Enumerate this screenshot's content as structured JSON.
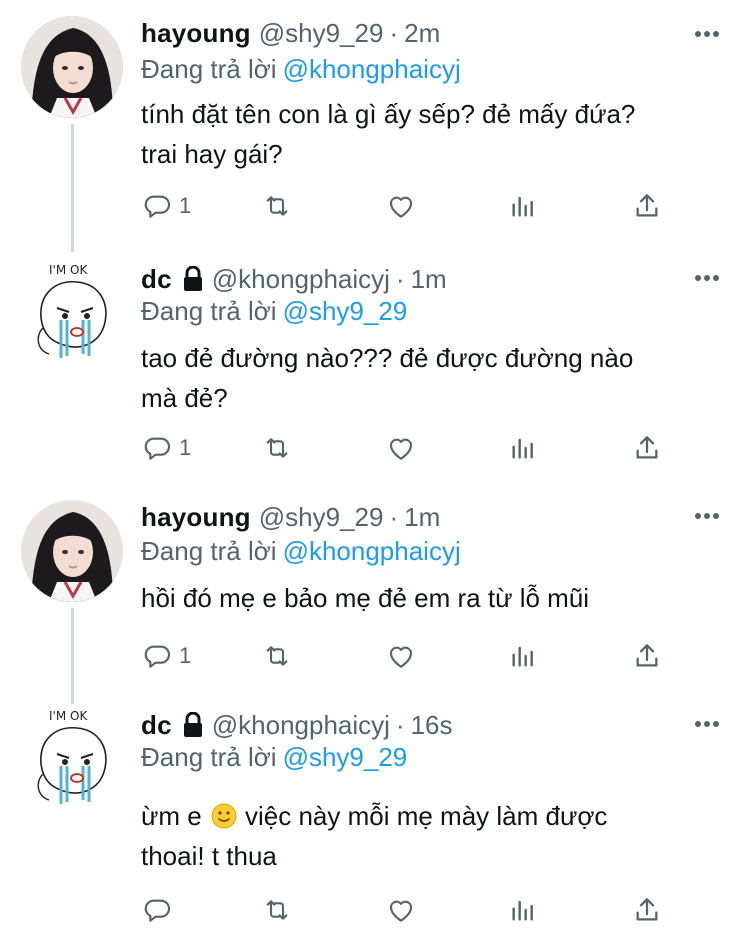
{
  "tweets": [
    {
      "display_name": "hayoung",
      "handle": "@shy9_29",
      "time": "2m",
      "locked": false,
      "replying_prefix": "Đang trả lời",
      "replying_to": "@khongphaicyj",
      "body": "tính đặt tên con là gì ấy sếp? đẻ mấy đứa?\ntrai hay gái?",
      "reply_count": "1",
      "avatar": "girl-photo"
    },
    {
      "display_name": "dc",
      "handle": "@khongphaicyj",
      "time": "1m",
      "locked": true,
      "replying_prefix": "Đang trả lời",
      "replying_to": "@shy9_29",
      "body": "tao đẻ đường nào??? đẻ được đường nào\nmà đẻ?",
      "reply_count": "1",
      "avatar": "im-ok-sketch"
    },
    {
      "display_name": "hayoung",
      "handle": "@shy9_29",
      "time": "1m",
      "locked": false,
      "replying_prefix": "Đang trả lời",
      "replying_to": "@khongphaicyj",
      "body": "hồi đó mẹ e bảo mẹ đẻ em ra từ lỗ mũi",
      "reply_count": "1",
      "avatar": "girl-photo"
    },
    {
      "display_name": "dc",
      "handle": "@khongphaicyj",
      "time": "16s",
      "locked": true,
      "replying_prefix": "Đang trả lời",
      "replying_to": "@shy9_29",
      "body_before_emoji": "ừm e",
      "body_after_emoji": "việc này mỗi mẹ mày làm được\nthoai! t thua",
      "emoji": "slightly-smiling-face",
      "reply_count": "",
      "avatar": "im-ok-sketch"
    }
  ],
  "sketch_caption": "I'M OK",
  "separator": "·",
  "colors": {
    "text": "#0f1419",
    "secondary": "#536471",
    "link": "#1d9bf0",
    "thread_line": "#cfd9de"
  }
}
